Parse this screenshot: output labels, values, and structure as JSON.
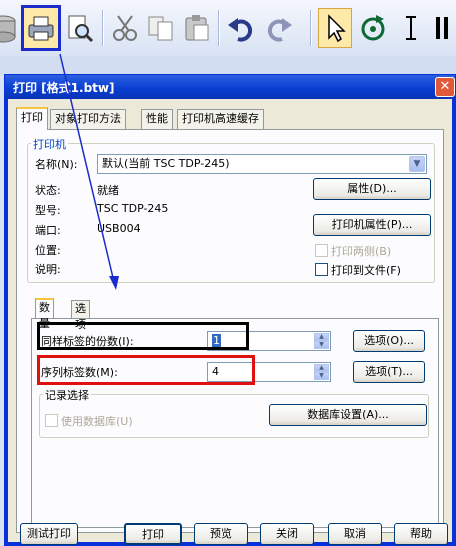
{
  "toolbar": {
    "icons": [
      "database-icon",
      "print-icon",
      "print-preview-icon",
      "cut-icon",
      "copy-icon",
      "paste-icon",
      "undo-icon",
      "redo-icon",
      "pointer-icon",
      "rotate-icon",
      "text-cursor-icon",
      "column-icon"
    ],
    "highlight_color": "#1b2bcc"
  },
  "dialog": {
    "title": "打印  [格式1.btw]",
    "close_symbol": "✕",
    "tabs": [
      "打印",
      "对象打印方法",
      "性能",
      "打印机高速缓存"
    ],
    "printer": {
      "group_label": "打印机",
      "name_label": "名称(N):",
      "name_value": "默认(当前 TSC TDP-245)",
      "status_label": "状态:",
      "status_value": "就绪",
      "model_label": "型号:",
      "model_value": "TSC TDP-245",
      "port_label": "端口:",
      "port_value": "USB004",
      "location_label": "位置:",
      "location_value": "",
      "comment_label": "说明:",
      "comment_value": "",
      "properties_button": "属性(D)...",
      "printer_properties_button": "打印机属性(P)...",
      "duplex_label": "打印两侧(B)",
      "print_to_file_label": "打印到文件(F)"
    },
    "inner_tabs": [
      "数量",
      "选项"
    ],
    "quantity": {
      "copies_label": "同样标签的份数(I):",
      "copies_value": "1",
      "copies_options_button": "选项(O)...",
      "serial_label": "序列标签数(M):",
      "serial_value": "4",
      "serial_options_button": "选项(T)..."
    },
    "record": {
      "group_label": "记录选择",
      "use_db_label": "使用数据库(U)",
      "db_settings_button": "数据库设置(A)..."
    },
    "footer": {
      "test_print": "测试打印",
      "print": "打印",
      "preview": "预览",
      "close": "关闭",
      "cancel": "取消",
      "help": "帮助"
    }
  },
  "colors": {
    "annotation_black": "#000000",
    "annotation_red": "#e01010",
    "annotation_arrow": "#1b2bcc"
  }
}
